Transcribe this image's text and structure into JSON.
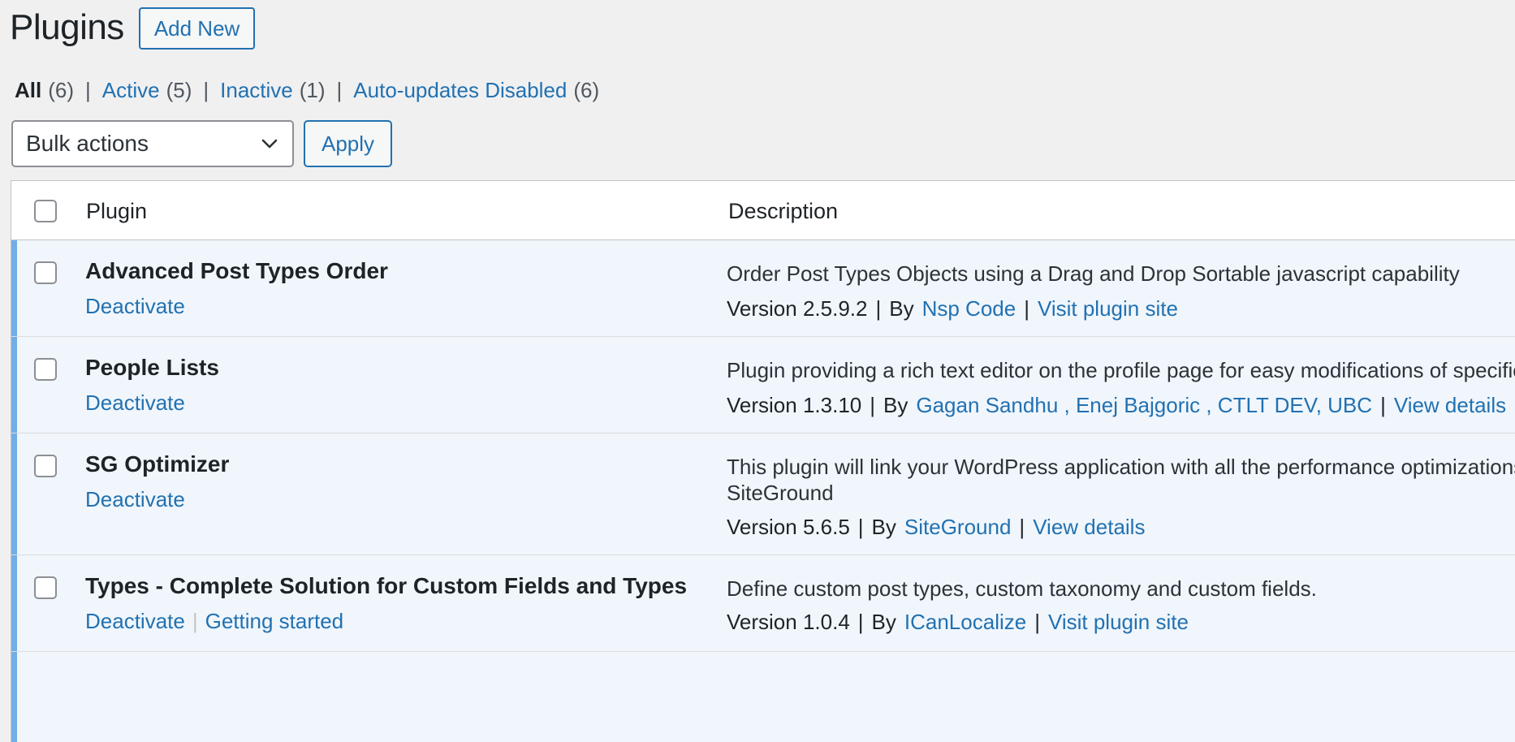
{
  "header": {
    "title": "Plugins",
    "add_new": "Add New"
  },
  "filters": [
    {
      "label": "All",
      "count": "(6)",
      "current": true
    },
    {
      "label": "Active",
      "count": "(5)",
      "current": false
    },
    {
      "label": "Inactive",
      "count": "(1)",
      "current": false
    },
    {
      "label": "Auto-updates Disabled",
      "count": "(6)",
      "current": false
    }
  ],
  "filter_separator": "|",
  "bulk": {
    "selected": "Bulk actions",
    "apply": "Apply"
  },
  "table": {
    "col_plugin": "Plugin",
    "col_description": "Description",
    "meta_separator": "|",
    "by_label": "By",
    "rows": [
      {
        "name": "Advanced Post Types Order",
        "actions": [
          "Deactivate"
        ],
        "description": "Order Post Types Objects using a Drag and Drop Sortable javascript capability",
        "version": "Version 2.5.9.2",
        "authors": "Nsp Code",
        "link": "Visit plugin site"
      },
      {
        "name": "People Lists",
        "actions": [
          "Deactivate"
        ],
        "description": "Plugin providing a rich text editor on the profile page for easy modifications of specific user profile information",
        "version": "Version 1.3.10",
        "authors": "Gagan Sandhu , Enej Bajgoric , CTLT DEV, UBC",
        "link": "View details"
      },
      {
        "name": "SG Optimizer",
        "actions": [
          "Deactivate"
        ],
        "description": "This plugin will link your WordPress application with all the performance optimizations provided by",
        "description_line2": "SiteGround",
        "version": "Version 5.6.5",
        "authors": "SiteGround",
        "link": "View details"
      },
      {
        "name": "Types - Complete Solution for Custom Fields and Types",
        "actions": [
          "Deactivate",
          "Getting started"
        ],
        "description": "Define custom post types, custom taxonomy and custom fields.",
        "version": "Version 1.0.4",
        "authors": "ICanLocalize",
        "link": "Visit plugin site"
      }
    ]
  },
  "colors": {
    "link": "#2271b1",
    "active_bar": "#72aee6",
    "active_row_bg": "#f0f6fc"
  }
}
